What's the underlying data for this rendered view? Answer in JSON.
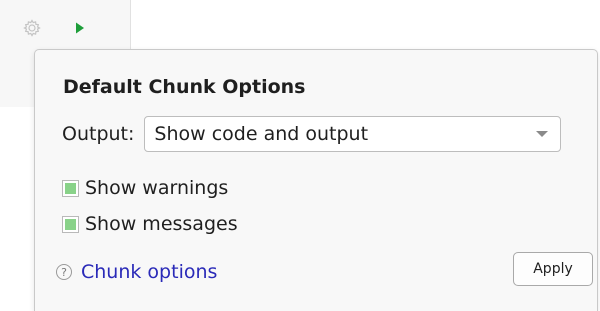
{
  "toolbar": {
    "gear_icon": "gear-icon",
    "run_icon": "play-triangle-icon",
    "run_color": "#1e9e3a"
  },
  "popup": {
    "title": "Default Chunk Options",
    "output_label": "Output:",
    "output_value": "Show code and output",
    "show_warnings": {
      "label": "Show warnings",
      "checked": true
    },
    "show_messages": {
      "label": "Show messages",
      "checked": true
    },
    "help_icon": "question-circle-icon",
    "help_link": "Chunk options",
    "apply_label": "Apply",
    "check_color": "#89d289",
    "link_color": "#2a2ab8"
  }
}
